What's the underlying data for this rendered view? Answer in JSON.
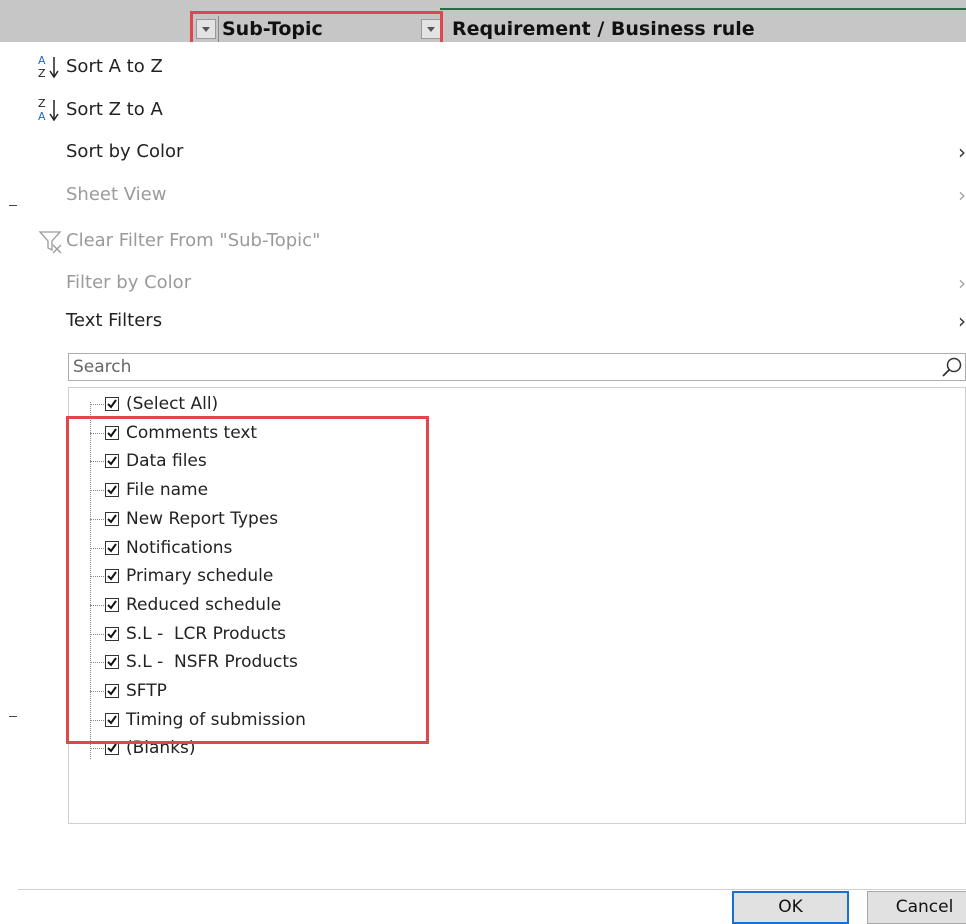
{
  "header": {
    "columns": [
      {
        "label": "Sub-Topic"
      },
      {
        "label": "Requirement / Business rule"
      }
    ]
  },
  "menu": {
    "sort_asc": {
      "label": "Sort A to Z"
    },
    "sort_desc": {
      "label": "Sort Z to A"
    },
    "sort_by_color": {
      "label": "Sort by Color"
    },
    "sheet_view": {
      "label": "Sheet View"
    },
    "clear_filter": {
      "label": "Clear Filter From \"Sub-Topic\""
    },
    "filter_by_color": {
      "label": "Filter by Color"
    },
    "text_filters": {
      "label": "Text Filters"
    }
  },
  "search": {
    "placeholder": "Search"
  },
  "filter_list": {
    "items": [
      {
        "label": "(Select All)",
        "checked": true
      },
      {
        "label": "Comments text",
        "checked": true
      },
      {
        "label": "Data files",
        "checked": true
      },
      {
        "label": "File name",
        "checked": true
      },
      {
        "label": "New Report Types",
        "checked": true
      },
      {
        "label": "Notifications",
        "checked": true
      },
      {
        "label": "Primary schedule",
        "checked": true
      },
      {
        "label": "Reduced schedule",
        "checked": true
      },
      {
        "label": "S.L -  LCR Products",
        "checked": true
      },
      {
        "label": "S.L -  NSFR Products",
        "checked": true
      },
      {
        "label": "SFTP",
        "checked": true
      },
      {
        "label": "Timing of submission",
        "checked": true
      },
      {
        "label": "(Blanks)",
        "checked": true
      }
    ]
  },
  "buttons": {
    "ok": "OK",
    "cancel": "Cancel"
  },
  "colors": {
    "highlight": "#e0474c",
    "ok_border": "#1a6fd0",
    "header_bg": "#c6c6c6"
  }
}
